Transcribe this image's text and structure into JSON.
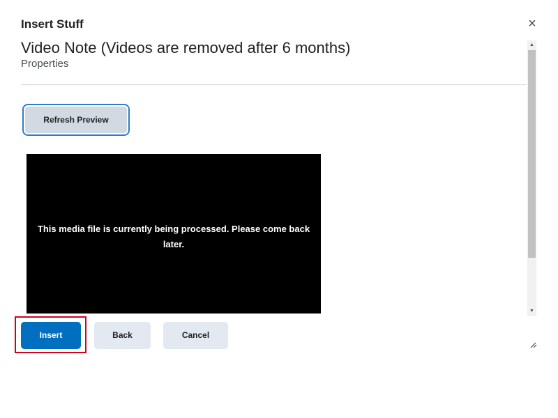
{
  "dialog": {
    "title": "Insert Stuff",
    "close_glyph": "×"
  },
  "content": {
    "heading": "Video Note (Videos are removed after 6 months)",
    "subheading": "Properties",
    "refresh_label": "Refresh Preview",
    "media_message": "This media file is currently being processed. Please come back later."
  },
  "scrollbar": {
    "up_glyph": "▲",
    "down_glyph": "▼"
  },
  "footer": {
    "insert_label": "Insert",
    "back_label": "Back",
    "cancel_label": "Cancel"
  },
  "icons": {
    "close": "close-icon",
    "resize": "resize-grip-icon"
  },
  "colors": {
    "primary_button": "#006fbf",
    "secondary_button": "#e3e9f1",
    "highlight": "#d0021b",
    "focus_ring": "#2d7dc7"
  }
}
